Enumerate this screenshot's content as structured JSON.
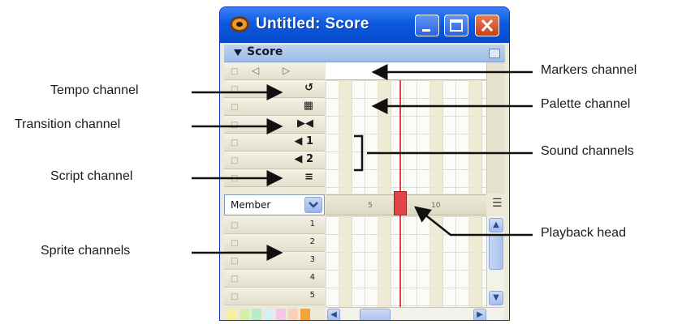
{
  "window": {
    "title": "Untitled: Score",
    "panel_title": "Score",
    "member_label": "Member"
  },
  "channels": {
    "top_nav": [
      "◁",
      "▷"
    ],
    "tempo_icon": "↺",
    "palette_icon": "▦",
    "transition_icon": "▶◀",
    "sound1": "◀ 1",
    "sound2": "◀ 2",
    "script_icon": "≡"
  },
  "sprite_numbers": [
    "1",
    "2",
    "3",
    "4",
    "5"
  ],
  "ruler_ticks": [
    "5",
    "10"
  ],
  "labels": {
    "tempo": "Tempo channel",
    "transition": "Transition channel",
    "script": "Script channel",
    "sprite": "Sprite channels",
    "markers": "Markers channel",
    "palette": "Palette channel",
    "sound": "Sound channels",
    "playback": "Playback head"
  },
  "colors": {
    "title_bar": "#0a5ae0",
    "playhead": "#e0454a",
    "swatches": [
      "#f7f0a0",
      "#d3f0a8",
      "#b8ecc8",
      "#d7f0f8",
      "#f2c7e8",
      "#f9d0b8",
      "#f6a23a"
    ]
  }
}
